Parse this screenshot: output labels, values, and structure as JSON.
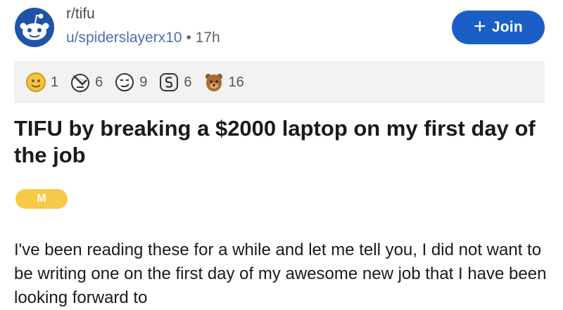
{
  "post": {
    "subreddit": "r/tifu",
    "author": "u/spiderslayerx10",
    "separator": "•",
    "age": "17h",
    "join_label": "Join",
    "join_icon": "plus-icon",
    "awards": [
      {
        "icon": "gold-medal-icon",
        "count": "1"
      },
      {
        "icon": "facepalm-icon",
        "count": "6"
      },
      {
        "icon": "smirk-face-icon",
        "count": "9"
      },
      {
        "icon": "silver-coin-icon",
        "count": "6"
      },
      {
        "icon": "bear-icon",
        "count": "16"
      }
    ],
    "title": "TIFU by breaking a $2000 laptop on my first day of the job",
    "flair": "M",
    "body": "I've been reading these for a while and let me tell you, I did not want to be writing one on the first day of my awesome new job that I have been looking forward to"
  },
  "colors": {
    "join_bg": "#1b5fc6",
    "flair_bg": "#f7c948",
    "link": "#4a6fb0",
    "awards_bg": "#f2f2f2"
  }
}
